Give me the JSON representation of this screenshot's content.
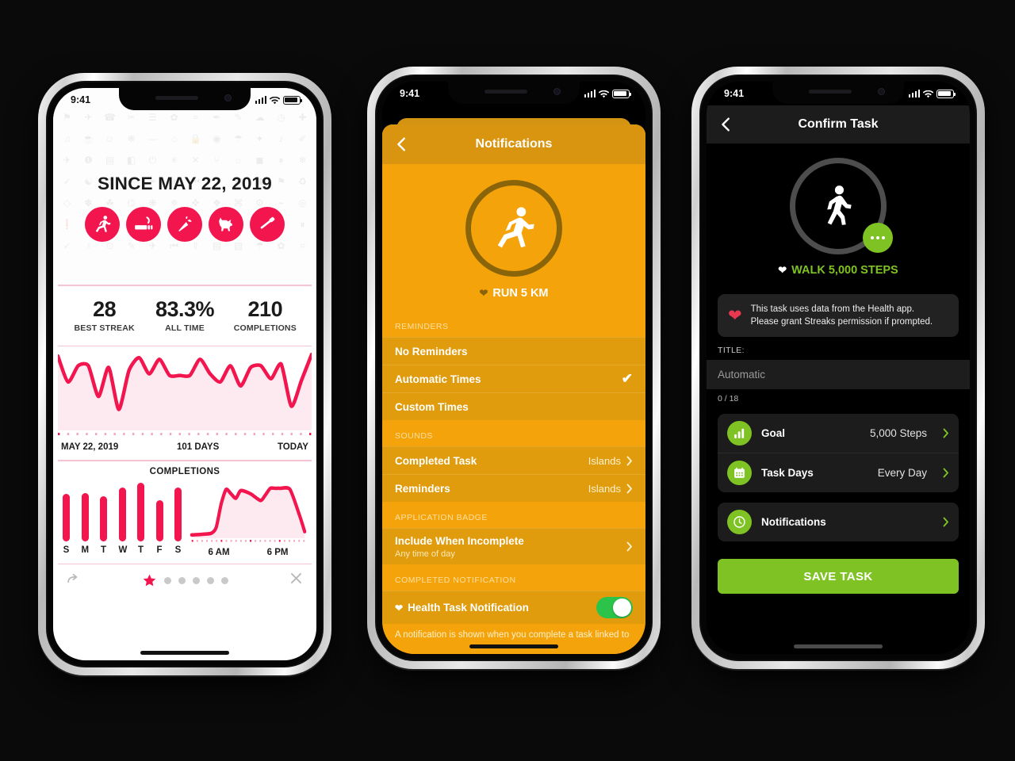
{
  "app": {
    "accent_pink": "#f2154e",
    "accent_orange": "#f5a30a",
    "accent_green": "#7fc224"
  },
  "phone1": {
    "status": {
      "time": "9:41"
    },
    "hero": {
      "since_label": "SINCE MAY 22, 2019",
      "task_icons": [
        "run-icon",
        "no-smoking-icon",
        "carrot-icon",
        "dog-icon",
        "toothbrush-icon"
      ]
    },
    "stats": [
      {
        "value": "28",
        "label": "BEST STREAK"
      },
      {
        "value": "83.3%",
        "label": "ALL TIME"
      },
      {
        "value": "210",
        "label": "COMPLETIONS"
      }
    ],
    "timeline": {
      "start": "MAY 22, 2019",
      "middle": "101 DAYS",
      "end": "TODAY"
    },
    "completions_title": "COMPLETIONS",
    "weekday_labels": [
      "S",
      "M",
      "T",
      "W",
      "T",
      "F",
      "S"
    ],
    "time_labels": [
      "6 AM",
      "6 PM"
    ],
    "footer": {
      "share_icon": "share-icon",
      "close_icon": "close-icon",
      "page_count": 6,
      "active_page": 1
    }
  },
  "phone2": {
    "status": {
      "time": "9:41"
    },
    "nav": {
      "back_icon": "chevron-left-icon",
      "title": "Notifications"
    },
    "hero": {
      "icon": "run-icon",
      "task_name": "RUN 5 KM",
      "heart_icon": "heart-icon"
    },
    "sections": [
      {
        "header": "REMINDERS",
        "rows": [
          {
            "label": "No Reminders",
            "checked": false
          },
          {
            "label": "Automatic Times",
            "checked": true
          },
          {
            "label": "Custom Times",
            "checked": false
          }
        ]
      },
      {
        "header": "SOUNDS",
        "rows": [
          {
            "label": "Completed Task",
            "value": "Islands",
            "chevron": true
          },
          {
            "label": "Reminders",
            "value": "Islands",
            "chevron": true
          }
        ]
      },
      {
        "header": "APPLICATION BADGE",
        "rows": [
          {
            "label": "Include When Incomplete",
            "sub": "Any time of day",
            "chevron": true
          }
        ]
      },
      {
        "header": "COMPLETED NOTIFICATION",
        "rows": [
          {
            "label": "Health Task Notification",
            "heart": true,
            "toggle": true,
            "toggle_on": true
          }
        ]
      }
    ],
    "footer_note": "A notification is shown when you complete a task linked to"
  },
  "phone3": {
    "status": {
      "time": "9:41"
    },
    "nav": {
      "back_icon": "chevron-left-icon",
      "title": "Confirm Task"
    },
    "hero": {
      "icon": "walk-icon",
      "task_name": "WALK 5,000 STEPS",
      "heart_icon": "heart-icon",
      "more_icon": "ellipsis-icon"
    },
    "note": {
      "icon": "heart-icon",
      "line1": "This task uses data from the Health app.",
      "line2": "Please grant Streaks permission if prompted."
    },
    "title_field": {
      "label": "TITLE:",
      "placeholder": "Automatic",
      "counter": "0 / 18"
    },
    "rows": [
      {
        "icon": "bar-chart-icon",
        "label": "Goal",
        "value": "5,000 Steps",
        "chevron": true
      },
      {
        "icon": "calendar-icon",
        "label": "Task Days",
        "value": "Every Day",
        "chevron": true
      },
      {
        "icon": "clock-icon",
        "label": "Notifications",
        "value": "",
        "chevron": true
      }
    ],
    "save_button": "SAVE TASK"
  },
  "chart_data": [
    {
      "type": "line",
      "title": "Completion rate timeline",
      "xlabel": "",
      "ylabel": "",
      "x_ticks": [
        "MAY 22, 2019",
        "101 DAYS",
        "TODAY"
      ],
      "ylim": [
        0,
        100
      ],
      "values": [
        92,
        60,
        80,
        80,
        42,
        78,
        26,
        74,
        90,
        70,
        88,
        68,
        68,
        68,
        88,
        70,
        60,
        80,
        55,
        78,
        80,
        64,
        82,
        30,
        62,
        94
      ]
    },
    {
      "type": "bar",
      "title": "COMPLETIONS",
      "categories": [
        "S",
        "M",
        "T",
        "W",
        "T",
        "F",
        "S"
      ],
      "values": [
        76,
        78,
        72,
        86,
        94,
        66,
        86
      ],
      "ylim": [
        0,
        100
      ]
    },
    {
      "type": "area",
      "title": "Completions by time of day",
      "x_ticks": [
        "6 AM",
        "6 PM"
      ],
      "x": [
        0,
        2,
        4,
        5,
        6,
        7,
        8,
        9,
        10,
        12,
        14,
        15,
        16,
        17,
        18,
        20,
        22,
        23
      ],
      "values": [
        6,
        7,
        9,
        20,
        62,
        88,
        80,
        72,
        86,
        80,
        68,
        78,
        90,
        90,
        90,
        88,
        40,
        12
      ],
      "ylim": [
        0,
        100
      ]
    }
  ]
}
